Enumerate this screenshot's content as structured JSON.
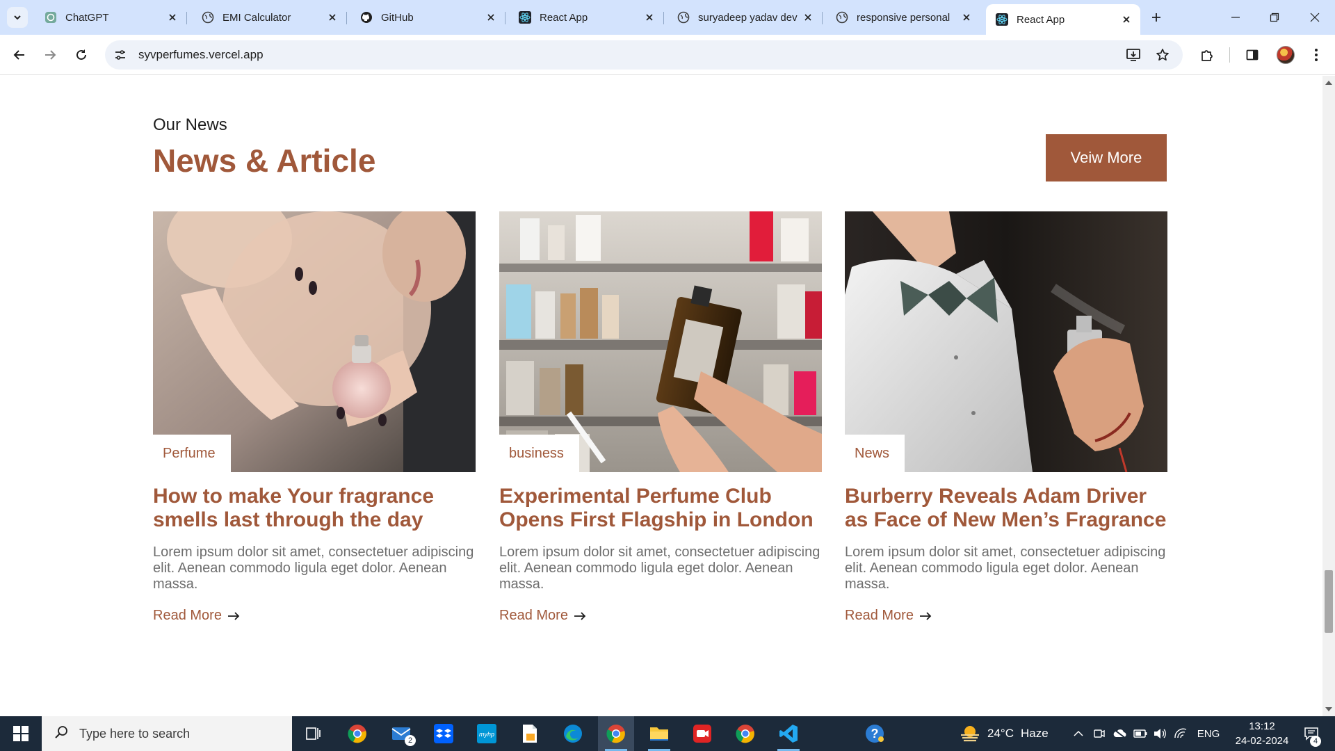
{
  "browser": {
    "tabs": [
      {
        "title": "ChatGPT",
        "icon": "chatgpt-icon"
      },
      {
        "title": "EMI Calculator",
        "icon": "globe-icon"
      },
      {
        "title": "GitHub",
        "icon": "github-icon"
      },
      {
        "title": "React App",
        "icon": "react-icon"
      },
      {
        "title": "suryadeep yadav dev",
        "icon": "globe-icon"
      },
      {
        "title": "responsive personal",
        "icon": "globe-icon"
      },
      {
        "title": "React App",
        "icon": "react-icon",
        "active": true
      }
    ],
    "url": "syvperfumes.vercel.app"
  },
  "page": {
    "eyebrow": "Our News",
    "title": "News & Article",
    "view_more_label": "Veiw More",
    "accent_color": "#a0583a",
    "articles": [
      {
        "tag": "Perfume",
        "title": "How to make Your fragrance smells last through the day",
        "excerpt": "Lorem ipsum dolor sit amet, consectetuer adipiscing elit. Aenean commodo ligula eget dolor. Aenean massa.",
        "read_more": "Read More"
      },
      {
        "tag": "business",
        "title": "Experimental Perfume Club Opens First Flagship in London",
        "excerpt": "Lorem ipsum dolor sit amet, consectetuer adipiscing elit. Aenean commodo ligula eget dolor. Aenean massa.",
        "read_more": "Read More"
      },
      {
        "tag": "News",
        "title": "Burberry Reveals Adam Driver as Face of New Men’s Fragrance",
        "excerpt": "Lorem ipsum dolor sit amet, consectetuer adipiscing elit. Aenean commodo ligula eget dolor. Aenean massa.",
        "read_more": "Read More"
      }
    ]
  },
  "taskbar": {
    "search_placeholder": "Type here to search",
    "mail_badge": "2",
    "weather": {
      "temp": "24°C",
      "condition": "Haze"
    },
    "language": "ENG",
    "time": "13:12",
    "date": "24-02-2024",
    "notification_count": "4"
  }
}
